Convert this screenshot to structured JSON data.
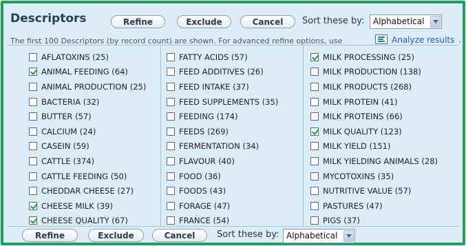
{
  "header": {
    "title": "Descriptors",
    "buttons": {
      "refine": "Refine",
      "exclude": "Exclude",
      "cancel": "Cancel"
    },
    "sort_label": "Sort these by:",
    "sort_value": "Alphabetical"
  },
  "info": {
    "text": "The first 100 Descriptors (by record count) are shown. For advanced refine options, use",
    "analyze_link": "Analyze results",
    "dot": "."
  },
  "columns": [
    [
      {
        "label": "AFLATOXINS (25)",
        "checked": false
      },
      {
        "label": "ANIMAL FEEDING (64)",
        "checked": true
      },
      {
        "label": "ANIMAL PRODUCTION (25)",
        "checked": false
      },
      {
        "label": "BACTERIA (32)",
        "checked": false
      },
      {
        "label": "BUTTER (57)",
        "checked": false
      },
      {
        "label": "CALCIUM (24)",
        "checked": false
      },
      {
        "label": "CASEIN (59)",
        "checked": false
      },
      {
        "label": "CATTLE (374)",
        "checked": false
      },
      {
        "label": "CATTLE FEEDING (50)",
        "checked": false
      },
      {
        "label": "CHEDDAR CHEESE (27)",
        "checked": false
      },
      {
        "label": "CHEESE MILK (39)",
        "checked": true
      },
      {
        "label": "CHEESE QUALITY (67)",
        "checked": true
      }
    ],
    [
      {
        "label": "FATTY ACIDS (57)",
        "checked": false
      },
      {
        "label": "FEED ADDITIVES (26)",
        "checked": false
      },
      {
        "label": "FEED INTAKE (37)",
        "checked": false
      },
      {
        "label": "FEED SUPPLEMENTS (35)",
        "checked": false
      },
      {
        "label": "FEEDING (174)",
        "checked": false
      },
      {
        "label": "FEEDS (269)",
        "checked": false
      },
      {
        "label": "FERMENTATION (34)",
        "checked": false
      },
      {
        "label": "FLAVOUR (40)",
        "checked": false
      },
      {
        "label": "FOOD (36)",
        "checked": false
      },
      {
        "label": "FOODS (43)",
        "checked": false
      },
      {
        "label": "FORAGE (47)",
        "checked": false
      },
      {
        "label": "FRANCE (54)",
        "checked": false
      }
    ],
    [
      {
        "label": "MILK PROCESSING (25)",
        "checked": true
      },
      {
        "label": "MILK PRODUCTION (138)",
        "checked": false
      },
      {
        "label": "MILK PRODUCTS (268)",
        "checked": false
      },
      {
        "label": "MILK PROTEIN (41)",
        "checked": false
      },
      {
        "label": "MILK PROTEINS (66)",
        "checked": false
      },
      {
        "label": "MILK QUALITY (123)",
        "checked": true
      },
      {
        "label": "MILK YIELD (151)",
        "checked": false
      },
      {
        "label": "MILK YIELDING ANIMALS (28)",
        "checked": false
      },
      {
        "label": "MYCOTOXINS (35)",
        "checked": false
      },
      {
        "label": "NUTRITIVE VALUE (57)",
        "checked": false
      },
      {
        "label": "PASTURES (47)",
        "checked": false
      },
      {
        "label": "PIGS (37)",
        "checked": false
      }
    ]
  ],
  "footer": {
    "buttons": {
      "refine": "Refine",
      "exclude": "Exclude",
      "cancel": "Cancel"
    },
    "sort_label": "Sort these by:",
    "sort_value": "Alphabetical"
  },
  "colors": {
    "border": "#1aa35a",
    "panel_bg": "#dcedf8",
    "link": "#1f5fb6",
    "check": "#1b9b3d"
  },
  "icons": {
    "analyze": "list-lines-icon",
    "dropdown": "chevron-down-icon",
    "checkbox": "checkbox-icon"
  }
}
